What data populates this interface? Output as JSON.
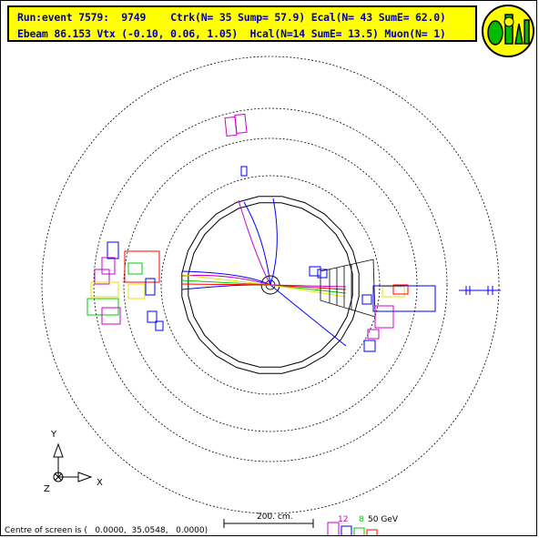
{
  "header": {
    "line1": "Run:event 7579:  9749    Ctrk(N= 35 Sump= 57.9) Ecal(N= 43 SumE= 62.0)",
    "line2": "Ebeam 86.153 Vtx (-0.10, 0.06, 1.05)  Hcal(N=14 SumE= 13.5) Muon(N= 1)"
  },
  "axes": {
    "y": "Y",
    "x": "X",
    "z": "Z"
  },
  "footer": {
    "centre_text": "Centre of screen is (   0.0000,  35.0548,   0.0000)",
    "scale_label": "200. cm.",
    "energy_scale": {
      "v12": "12",
      "v8": "8",
      "v50": "50 GeV"
    }
  },
  "colors": {
    "header_bg": "#ffff00",
    "header_text": "#0000aa",
    "track_blue": "#0000ff",
    "track_magenta": "#cc00cc",
    "ecal_yellow": "#e6e600",
    "ecal_green": "#00cc00",
    "ecal_red": "#ff0000",
    "logo_green": "#00bb00"
  }
}
